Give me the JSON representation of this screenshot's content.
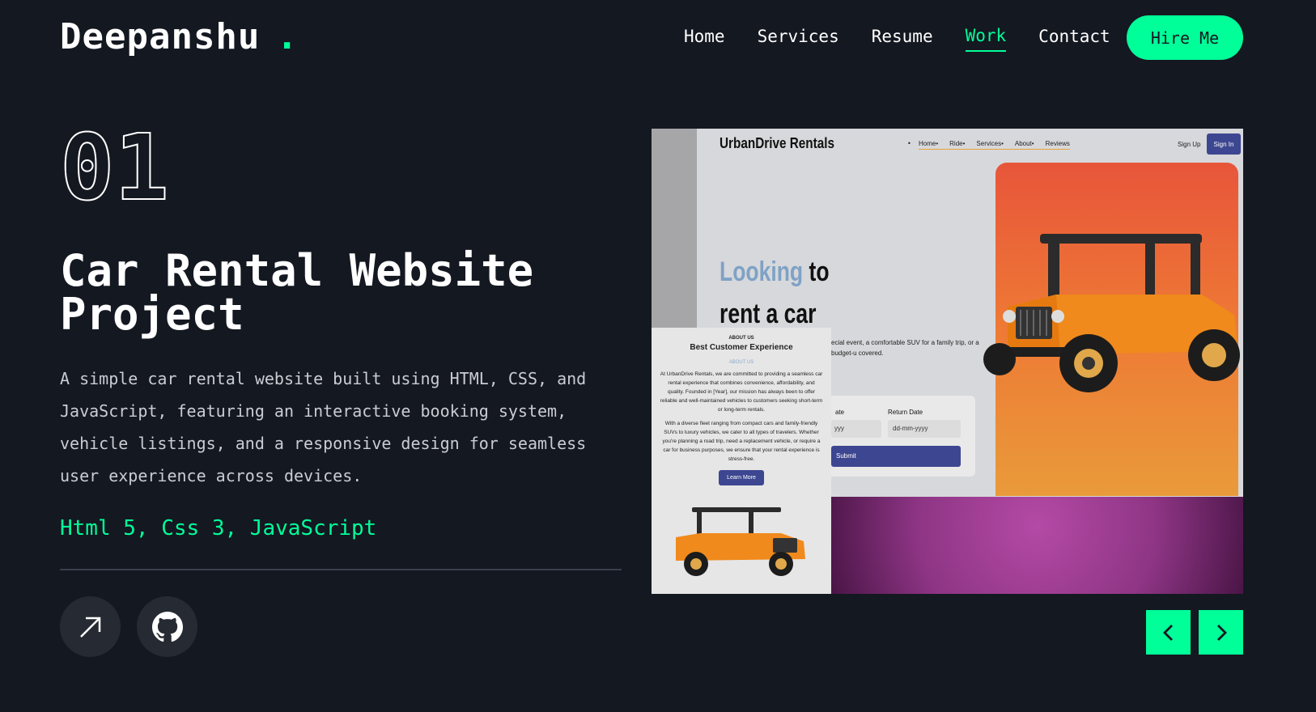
{
  "header": {
    "logo": "Deepanshu",
    "logo_dot": ".",
    "nav": [
      "Home",
      "Services",
      "Resume",
      "Work",
      "Contact"
    ],
    "active_nav": "Work",
    "hire_label": "Hire Me"
  },
  "project": {
    "number": "01",
    "title": "Car Rental Website Project",
    "description": "A simple car rental website built using HTML, CSS, and JavaScript, featuring an interactive booking system, vehicle listings, and a responsive design for seamless user experience across devices.",
    "stack": "Html 5, Css 3, JavaScript",
    "live_icon": "arrow-up-right-icon",
    "github_icon": "github-icon"
  },
  "preview": {
    "brand": "UrbanDrive Rentals",
    "nav": [
      "Home•",
      "Ride•",
      "Services•",
      "About•",
      "Reviews"
    ],
    "nav_bullet": "•",
    "signup": "Sign Up",
    "signin": "Sign In",
    "hero_highlight": "Looking",
    "hero_rest": " to",
    "hero_line2": "rent a car",
    "hero_desc": "ecial event, a comfortable SUV for a family trip, or a budget-u covered.",
    "form_label1": "ate",
    "form_label2": "Return Date",
    "form_input1": "yyy",
    "form_input2": "dd-mm-yyyy",
    "submit": "Submit",
    "about_small": "ABOUT US",
    "about_heading": "Best Customer Experience",
    "about_sub": "ABOUT US",
    "about_p1": "At UrbanDrive Rentals, we are committed to providing a seamless car rental experience that combines convenience, affordability, and quality. Founded in [Year], our mission has always been to offer reliable and well-maintained vehicles to customers seeking short-term or long-term rentals.",
    "about_p2": "With a diverse fleet ranging from compact cars and family-friendly SUVs to luxury vehicles, we cater to all types of travelers. Whether you're planning a road trip, need a replacement vehicle, or require a car for business purposes, we ensure that your rental experience is stress-free.",
    "learn_more": "Learn More"
  },
  "controls": {
    "prev_icon": "chevron-left-icon",
    "next_icon": "chevron-right-icon"
  },
  "colors": {
    "background": "#141821",
    "accent": "#00ff99",
    "text": "#ffffff",
    "muted": "#c9ccd3"
  }
}
